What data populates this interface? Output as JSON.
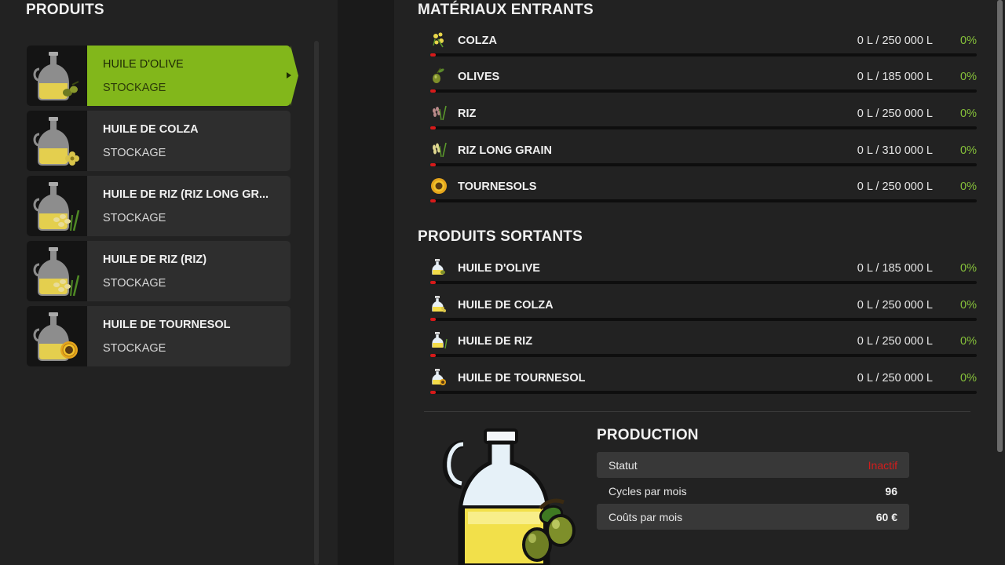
{
  "products_panel": {
    "title": "PRODUITS",
    "items": [
      {
        "name": "HUILE D'OLIVE",
        "sub": "STOCKAGE",
        "icon": "olive-oil-bottle-icon"
      },
      {
        "name": "HUILE DE COLZA",
        "sub": "STOCKAGE",
        "icon": "canola-oil-bottle-icon"
      },
      {
        "name": "HUILE DE RIZ (RIZ LONG GR...",
        "sub": "STOCKAGE",
        "icon": "rice-oil-bottle-icon"
      },
      {
        "name": "HUILE DE RIZ (RIZ)",
        "sub": "STOCKAGE",
        "icon": "rice-oil-bottle-icon"
      },
      {
        "name": "HUILE DE TOURNESOL",
        "sub": "STOCKAGE",
        "icon": "sunflower-oil-bottle-icon"
      }
    ]
  },
  "inputs": {
    "title": "MATÉRIAUX ENTRANTS",
    "rows": [
      {
        "name": "COLZA",
        "amount": "0 L / 250 000 L",
        "pct": "0%",
        "fill": 0
      },
      {
        "name": "OLIVES",
        "amount": "0 L / 185 000 L",
        "pct": "0%",
        "fill": 0
      },
      {
        "name": "RIZ",
        "amount": "0 L / 250 000 L",
        "pct": "0%",
        "fill": 0
      },
      {
        "name": "RIZ LONG GRAIN",
        "amount": "0 L / 310 000 L",
        "pct": "0%",
        "fill": 0
      },
      {
        "name": "TOURNESOLS",
        "amount": "0 L / 250 000 L",
        "pct": "0%",
        "fill": 0
      }
    ]
  },
  "outputs": {
    "title": "PRODUITS SORTANTS",
    "rows": [
      {
        "name": "HUILE D'OLIVE",
        "amount": "0 L / 185 000 L",
        "pct": "0%",
        "fill": 0
      },
      {
        "name": "HUILE DE COLZA",
        "amount": "0 L / 250 000 L",
        "pct": "0%",
        "fill": 0
      },
      {
        "name": "HUILE DE RIZ",
        "amount": "0 L / 250 000 L",
        "pct": "0%",
        "fill": 0
      },
      {
        "name": "HUILE DE TOURNESOL",
        "amount": "0 L / 250 000 L",
        "pct": "0%",
        "fill": 0
      }
    ]
  },
  "production": {
    "title": "PRODUCTION",
    "status_label": "Statut",
    "status_value": "Inactif",
    "cycles_label": "Cycles par mois",
    "cycles_value": "96",
    "cost_label": "Coûts par mois",
    "cost_value": "60 €"
  },
  "colors": {
    "accent": "#82b71b",
    "percent": "#86c13a",
    "inactive": "#d41c1c",
    "bar_fill": "#d61a1a"
  }
}
